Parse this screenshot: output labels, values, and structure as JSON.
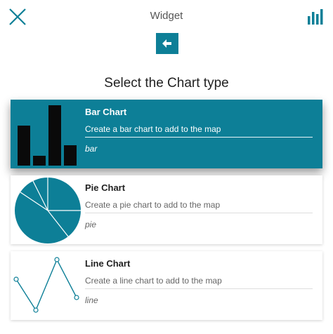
{
  "header": {
    "title": "Widget",
    "close_icon": "close-icon",
    "chart_icon": "bar-chart-icon"
  },
  "back_icon": "arrow-left-icon",
  "heading": "Select the Chart type",
  "colors": {
    "accent": "#0d7f97",
    "selected_text": "#ffffff"
  },
  "chart_types": [
    {
      "name": "Bar Chart",
      "description": "Create a bar chart to add to the map",
      "code": "bar",
      "selected": true
    },
    {
      "name": "Pie Chart",
      "description": "Create a pie chart to add to the map",
      "code": "pie",
      "selected": false
    },
    {
      "name": "Line Chart",
      "description": "Create a line chart to add to the map",
      "code": "line",
      "selected": false
    }
  ]
}
